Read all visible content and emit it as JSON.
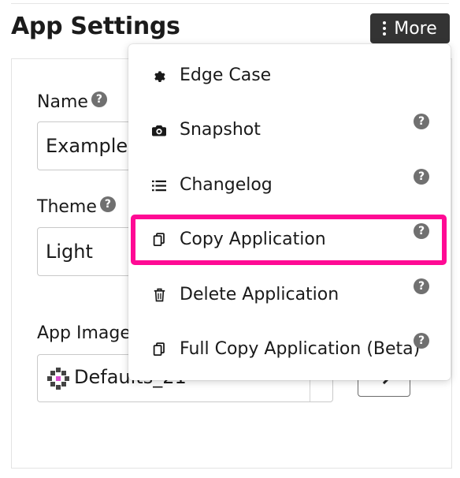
{
  "header": {
    "title": "App Settings",
    "more_label": "More"
  },
  "form": {
    "name_label": "Name",
    "name_value": "Example",
    "theme_label": "Theme",
    "theme_value": "Light",
    "image_label": "App Image",
    "image_value": "Defaults_21"
  },
  "menu": {
    "items": [
      {
        "label": "Edge Case",
        "icon": "gear-icon",
        "help": false
      },
      {
        "label": "Snapshot",
        "icon": "camera-icon",
        "help": true
      },
      {
        "label": "Changelog",
        "icon": "list-icon",
        "help": true
      },
      {
        "label": "Copy Application",
        "icon": "copy-icon",
        "help": true,
        "highlighted": true
      },
      {
        "label": "Delete Application",
        "icon": "trash-icon",
        "help": true
      },
      {
        "label": "Full Copy Application (Beta)",
        "icon": "copy-icon",
        "help": true
      }
    ],
    "help_glyph": "?"
  },
  "colors": {
    "highlight": "#ff0a94",
    "button_dark": "#333333",
    "help_icon": "#707070"
  }
}
